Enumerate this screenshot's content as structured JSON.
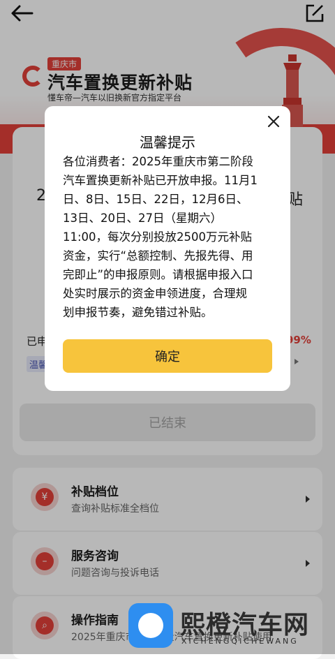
{
  "header": {
    "city_tag": "重庆市",
    "title": "汽车置换更新补贴",
    "subtitle": "懂车帝—汽车以旧换新官方指定平台"
  },
  "card": {
    "big_left": "2",
    "big_right": "贴",
    "applied_label": "已申",
    "percent": "99%",
    "tip_chip": "温馨",
    "ended_button": "已结束"
  },
  "list": [
    {
      "title": "补贴档位",
      "desc": "查询补贴标准全档位",
      "icon": "yen-icon",
      "glyph": "¥"
    },
    {
      "title": "服务咨询",
      "desc": "问题咨询与投诉电话",
      "icon": "chat-icon",
      "glyph": "–"
    },
    {
      "title": "操作指南",
      "desc": "2025年重庆市第二阶段汽车置换更新补贴使用",
      "icon": "search-doc-icon",
      "glyph": "⌕"
    }
  ],
  "modal": {
    "title": "温馨提示",
    "lines": [
      "各位消费者：2025年重庆市第二阶段",
      "汽车置换更新补贴已开放申报。11月1",
      "日、8日、15日、22日，12月6日、",
      "13日、20日、27日（星期六）",
      "11:00，每次分别投放2500万元补贴",
      "资金，实行“总额控制、先报先得、用",
      "完即止”的申报原则。请根据申报入口",
      "处实时展示的资金申领进度，合理规",
      "划申报节奏，避免错过补贴。"
    ],
    "confirm": "确定"
  },
  "watermark": {
    "text": "熙橙汽车网",
    "sub": "XICHENGQICHEWANG"
  },
  "colors": {
    "brand_red": "#e3413a",
    "confirm_yellow": "#f7c43c"
  }
}
